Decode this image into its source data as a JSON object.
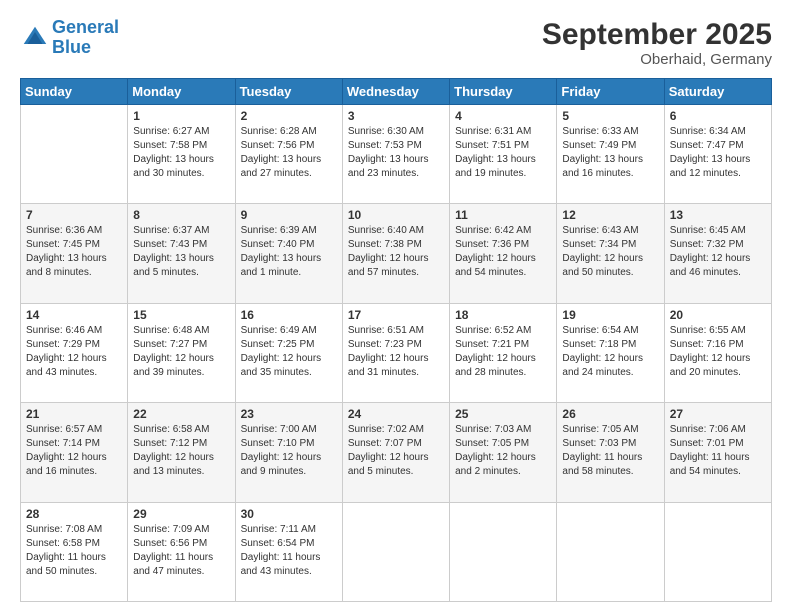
{
  "header": {
    "logo_line1": "General",
    "logo_line2": "Blue",
    "month": "September 2025",
    "location": "Oberhaid, Germany"
  },
  "weekdays": [
    "Sunday",
    "Monday",
    "Tuesday",
    "Wednesday",
    "Thursday",
    "Friday",
    "Saturday"
  ],
  "weeks": [
    [
      {
        "day": "",
        "sunrise": "",
        "sunset": "",
        "daylight": ""
      },
      {
        "day": "1",
        "sunrise": "Sunrise: 6:27 AM",
        "sunset": "Sunset: 7:58 PM",
        "daylight": "Daylight: 13 hours and 30 minutes."
      },
      {
        "day": "2",
        "sunrise": "Sunrise: 6:28 AM",
        "sunset": "Sunset: 7:56 PM",
        "daylight": "Daylight: 13 hours and 27 minutes."
      },
      {
        "day": "3",
        "sunrise": "Sunrise: 6:30 AM",
        "sunset": "Sunset: 7:53 PM",
        "daylight": "Daylight: 13 hours and 23 minutes."
      },
      {
        "day": "4",
        "sunrise": "Sunrise: 6:31 AM",
        "sunset": "Sunset: 7:51 PM",
        "daylight": "Daylight: 13 hours and 19 minutes."
      },
      {
        "day": "5",
        "sunrise": "Sunrise: 6:33 AM",
        "sunset": "Sunset: 7:49 PM",
        "daylight": "Daylight: 13 hours and 16 minutes."
      },
      {
        "day": "6",
        "sunrise": "Sunrise: 6:34 AM",
        "sunset": "Sunset: 7:47 PM",
        "daylight": "Daylight: 13 hours and 12 minutes."
      }
    ],
    [
      {
        "day": "7",
        "sunrise": "Sunrise: 6:36 AM",
        "sunset": "Sunset: 7:45 PM",
        "daylight": "Daylight: 13 hours and 8 minutes."
      },
      {
        "day": "8",
        "sunrise": "Sunrise: 6:37 AM",
        "sunset": "Sunset: 7:43 PM",
        "daylight": "Daylight: 13 hours and 5 minutes."
      },
      {
        "day": "9",
        "sunrise": "Sunrise: 6:39 AM",
        "sunset": "Sunset: 7:40 PM",
        "daylight": "Daylight: 13 hours and 1 minute."
      },
      {
        "day": "10",
        "sunrise": "Sunrise: 6:40 AM",
        "sunset": "Sunset: 7:38 PM",
        "daylight": "Daylight: 12 hours and 57 minutes."
      },
      {
        "day": "11",
        "sunrise": "Sunrise: 6:42 AM",
        "sunset": "Sunset: 7:36 PM",
        "daylight": "Daylight: 12 hours and 54 minutes."
      },
      {
        "day": "12",
        "sunrise": "Sunrise: 6:43 AM",
        "sunset": "Sunset: 7:34 PM",
        "daylight": "Daylight: 12 hours and 50 minutes."
      },
      {
        "day": "13",
        "sunrise": "Sunrise: 6:45 AM",
        "sunset": "Sunset: 7:32 PM",
        "daylight": "Daylight: 12 hours and 46 minutes."
      }
    ],
    [
      {
        "day": "14",
        "sunrise": "Sunrise: 6:46 AM",
        "sunset": "Sunset: 7:29 PM",
        "daylight": "Daylight: 12 hours and 43 minutes."
      },
      {
        "day": "15",
        "sunrise": "Sunrise: 6:48 AM",
        "sunset": "Sunset: 7:27 PM",
        "daylight": "Daylight: 12 hours and 39 minutes."
      },
      {
        "day": "16",
        "sunrise": "Sunrise: 6:49 AM",
        "sunset": "Sunset: 7:25 PM",
        "daylight": "Daylight: 12 hours and 35 minutes."
      },
      {
        "day": "17",
        "sunrise": "Sunrise: 6:51 AM",
        "sunset": "Sunset: 7:23 PM",
        "daylight": "Daylight: 12 hours and 31 minutes."
      },
      {
        "day": "18",
        "sunrise": "Sunrise: 6:52 AM",
        "sunset": "Sunset: 7:21 PM",
        "daylight": "Daylight: 12 hours and 28 minutes."
      },
      {
        "day": "19",
        "sunrise": "Sunrise: 6:54 AM",
        "sunset": "Sunset: 7:18 PM",
        "daylight": "Daylight: 12 hours and 24 minutes."
      },
      {
        "day": "20",
        "sunrise": "Sunrise: 6:55 AM",
        "sunset": "Sunset: 7:16 PM",
        "daylight": "Daylight: 12 hours and 20 minutes."
      }
    ],
    [
      {
        "day": "21",
        "sunrise": "Sunrise: 6:57 AM",
        "sunset": "Sunset: 7:14 PM",
        "daylight": "Daylight: 12 hours and 16 minutes."
      },
      {
        "day": "22",
        "sunrise": "Sunrise: 6:58 AM",
        "sunset": "Sunset: 7:12 PM",
        "daylight": "Daylight: 12 hours and 13 minutes."
      },
      {
        "day": "23",
        "sunrise": "Sunrise: 7:00 AM",
        "sunset": "Sunset: 7:10 PM",
        "daylight": "Daylight: 12 hours and 9 minutes."
      },
      {
        "day": "24",
        "sunrise": "Sunrise: 7:02 AM",
        "sunset": "Sunset: 7:07 PM",
        "daylight": "Daylight: 12 hours and 5 minutes."
      },
      {
        "day": "25",
        "sunrise": "Sunrise: 7:03 AM",
        "sunset": "Sunset: 7:05 PM",
        "daylight": "Daylight: 12 hours and 2 minutes."
      },
      {
        "day": "26",
        "sunrise": "Sunrise: 7:05 AM",
        "sunset": "Sunset: 7:03 PM",
        "daylight": "Daylight: 11 hours and 58 minutes."
      },
      {
        "day": "27",
        "sunrise": "Sunrise: 7:06 AM",
        "sunset": "Sunset: 7:01 PM",
        "daylight": "Daylight: 11 hours and 54 minutes."
      }
    ],
    [
      {
        "day": "28",
        "sunrise": "Sunrise: 7:08 AM",
        "sunset": "Sunset: 6:58 PM",
        "daylight": "Daylight: 11 hours and 50 minutes."
      },
      {
        "day": "29",
        "sunrise": "Sunrise: 7:09 AM",
        "sunset": "Sunset: 6:56 PM",
        "daylight": "Daylight: 11 hours and 47 minutes."
      },
      {
        "day": "30",
        "sunrise": "Sunrise: 7:11 AM",
        "sunset": "Sunset: 6:54 PM",
        "daylight": "Daylight: 11 hours and 43 minutes."
      },
      {
        "day": "",
        "sunrise": "",
        "sunset": "",
        "daylight": ""
      },
      {
        "day": "",
        "sunrise": "",
        "sunset": "",
        "daylight": ""
      },
      {
        "day": "",
        "sunrise": "",
        "sunset": "",
        "daylight": ""
      },
      {
        "day": "",
        "sunrise": "",
        "sunset": "",
        "daylight": ""
      }
    ]
  ]
}
